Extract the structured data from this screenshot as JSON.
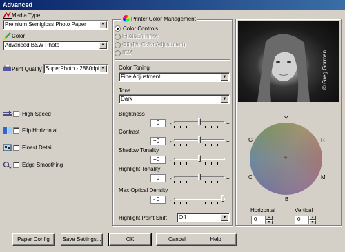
{
  "window": {
    "title": "Advanced"
  },
  "left": {
    "media_type_label": "Media Type",
    "media_type_value": "Premium Semigloss Photo Paper",
    "color_label": "Color",
    "color_value": "Advanced B&W Photo",
    "print_quality_label": "Print Quality",
    "print_quality_value": "SuperPhoto - 2880dpi",
    "options": [
      {
        "label": "High Speed",
        "checked": false
      },
      {
        "label": "Flip Horizontal",
        "checked": false
      },
      {
        "label": "Finest Detail",
        "checked": false
      },
      {
        "label": "Edge Smoothing",
        "checked": false
      }
    ]
  },
  "pcm": {
    "title": "Printer Color Management",
    "radios": [
      {
        "label": "Color Controls",
        "selected": true,
        "enabled": true
      },
      {
        "label": "PhotoEnhance",
        "selected": false,
        "enabled": false
      },
      {
        "label": "Off (No Color Adjustment)",
        "selected": false,
        "enabled": false
      },
      {
        "label": "ICM",
        "selected": false,
        "enabled": false
      }
    ],
    "color_toning_label": "Color Toning",
    "color_toning_value": "Fine Adjustment",
    "tone_label": "Tone",
    "tone_value": "Dark",
    "sliders": [
      {
        "label": "Brightness",
        "value": "+0",
        "minus": "-",
        "plus": "+"
      },
      {
        "label": "Contrast",
        "value": "+0",
        "minus": "-",
        "plus": "+"
      },
      {
        "label": "Shadow Tonality",
        "value": "+0",
        "minus": "-",
        "plus": "+"
      },
      {
        "label": "Highlight Tonality",
        "value": "+0",
        "minus": "-",
        "plus": "+"
      },
      {
        "label": "Max Optical Density",
        "value": "- 0",
        "minus": "-",
        "plus": "+"
      }
    ],
    "highlight_point_shift_label": "Highlight Point Shift",
    "highlight_point_shift_value": "Off"
  },
  "preview": {
    "copyright": "© Greg Gorman",
    "wheel_labels": {
      "Y": "Y",
      "R": "R",
      "M": "M",
      "B": "B",
      "C": "C",
      "G": "G"
    },
    "horizontal_label": "Horizontal",
    "horizontal_value": "0",
    "vertical_label": "Vertical",
    "vertical_value": "0"
  },
  "buttons": {
    "paper_config": "Paper Config",
    "save_settings": "Save Settings...",
    "ok": "OK",
    "cancel": "Cancel",
    "help": "Help"
  },
  "colors": {
    "titlebar": "#0a246a",
    "dialog_bg": "#d4d0c8",
    "wheel_center_mark": "#ff0000"
  }
}
